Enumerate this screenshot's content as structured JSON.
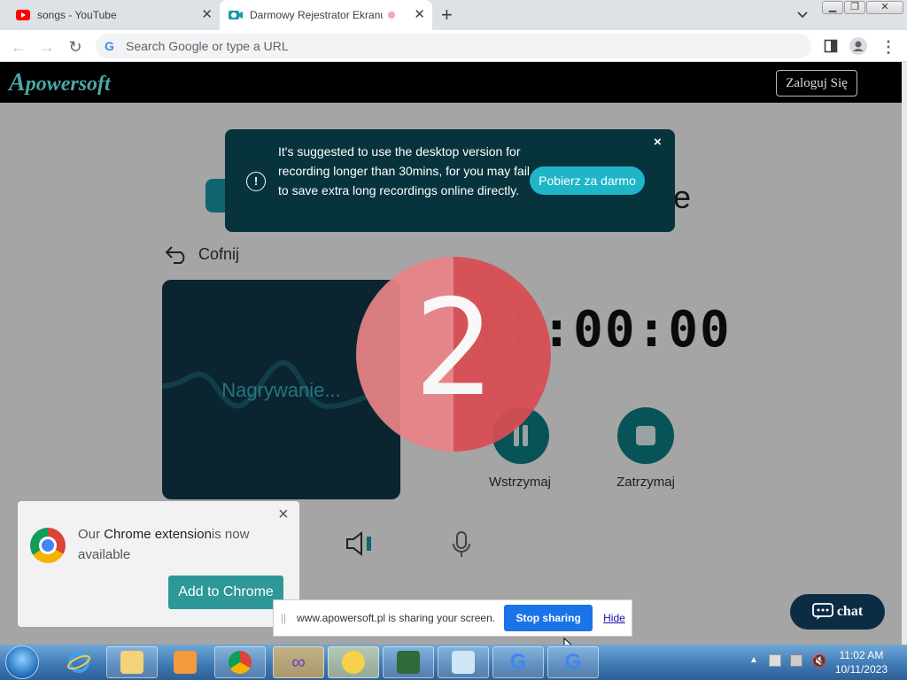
{
  "browser": {
    "tabs": [
      {
        "title": "songs - YouTube",
        "icon": "youtube-icon",
        "active": false
      },
      {
        "title": "Darmowy Rejestrator Ekranu",
        "icon": "apowersoft-icon",
        "active": true
      }
    ],
    "omnibox_placeholder": "Search Google or type a URL"
  },
  "page": {
    "logo_text": "powersoft",
    "logo_initial": "A",
    "login_label": "Zaloguj Się",
    "heading_fragment": "e",
    "back_label": "Cofnij",
    "preview_label": "Nagrywanie...",
    "timer": {
      "hours": "00",
      "minutes": "00",
      "seconds": "00"
    },
    "pause_label": "Wstrzymaj",
    "stop_label": "Zatrzymaj",
    "countdown_value": "2",
    "notice": {
      "text": "It's suggested to use the desktop version for recording longer than 30mins, for you may fail to save extra long recordings online directly.",
      "button": "Pobierz za darmo",
      "close": "×"
    },
    "extension_popup": {
      "text_prefix": "Our ",
      "text_bold": "Chrome extension",
      "text_suffix": "is now available",
      "button": "Add to Chrome",
      "close": "×"
    },
    "chat_label": "chat"
  },
  "share_bar": {
    "message": "www.apowersoft.pl is sharing your screen.",
    "stop_button": "Stop sharing",
    "hide_link": "Hide"
  },
  "taskbar": {
    "clock_time": "11:02 AM",
    "clock_date": "10/11/2023",
    "apps": [
      "internet-explorer-icon",
      "file-explorer-icon",
      "media-player-icon",
      "chrome-icon",
      "infinity-app-icon",
      "bee-app-icon",
      "system-monitor-icon",
      "notepad-icon",
      "google-icon",
      "google-icon"
    ]
  },
  "colors": {
    "accent": "#1fb5c8",
    "notice_bg": "#07333d",
    "countdown": "#d94d53",
    "share_blue": "#1a73e8"
  }
}
